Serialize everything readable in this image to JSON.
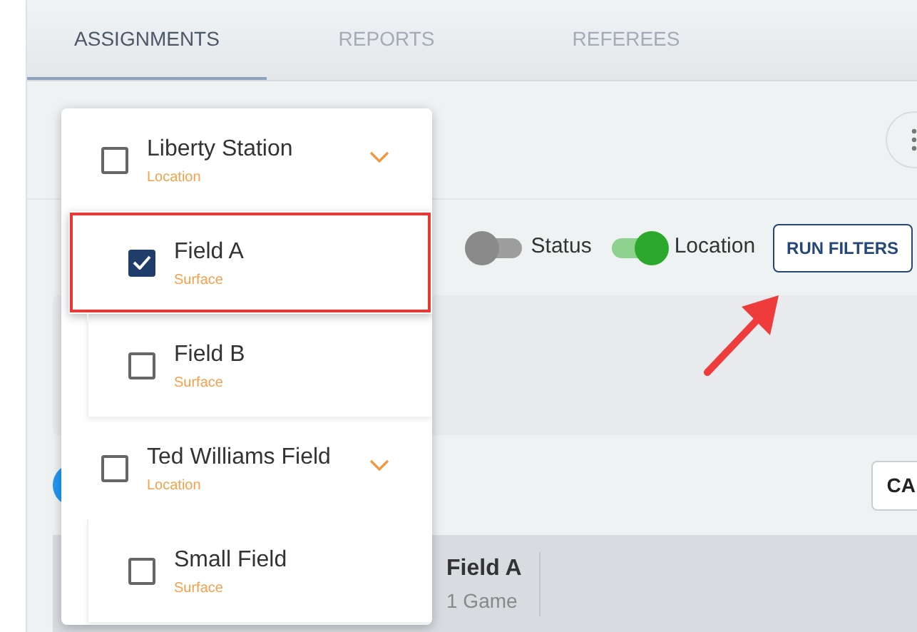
{
  "tabs": [
    {
      "label": "ASSIGNMENTS",
      "selected": true
    },
    {
      "label": "REPORTS",
      "selected": false
    },
    {
      "label": "REFEREES",
      "selected": false
    }
  ],
  "filters": {
    "toggles": [
      {
        "label": "Status",
        "on": false
      },
      {
        "label": "Location",
        "on": true
      }
    ],
    "button": "RUN FILTERS"
  },
  "secondary_button": "CA",
  "summary": {
    "title": "Field A",
    "subtitle": "1 Game"
  },
  "location_dropdown": [
    {
      "label": "Liberty Station",
      "type_label": "Location",
      "checked": false,
      "expanded": true,
      "children": [
        {
          "label": "Field A",
          "type_label": "Surface",
          "checked": true,
          "highlighted": true
        },
        {
          "label": "Field B",
          "type_label": "Surface",
          "checked": false,
          "highlighted": false
        }
      ]
    },
    {
      "label": "Ted Williams Field",
      "type_label": "Location",
      "checked": false,
      "expanded": true,
      "children": [
        {
          "label": "Small Field",
          "type_label": "Surface",
          "checked": false,
          "highlighted": false
        }
      ]
    }
  ]
}
